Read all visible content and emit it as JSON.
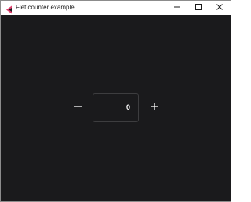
{
  "window": {
    "title": "Flet counter example"
  },
  "counter": {
    "value": "0"
  },
  "icons": {
    "app": "flet-logo-icon",
    "minimize": "minimize-icon",
    "maximize": "maximize-icon",
    "close": "close-icon",
    "decrement": "minus-icon",
    "increment": "plus-icon"
  },
  "colors": {
    "background": "#1a1a1c",
    "titlebar": "#ffffff",
    "accent_logo": "#e0406e",
    "text": "#ffffff"
  }
}
